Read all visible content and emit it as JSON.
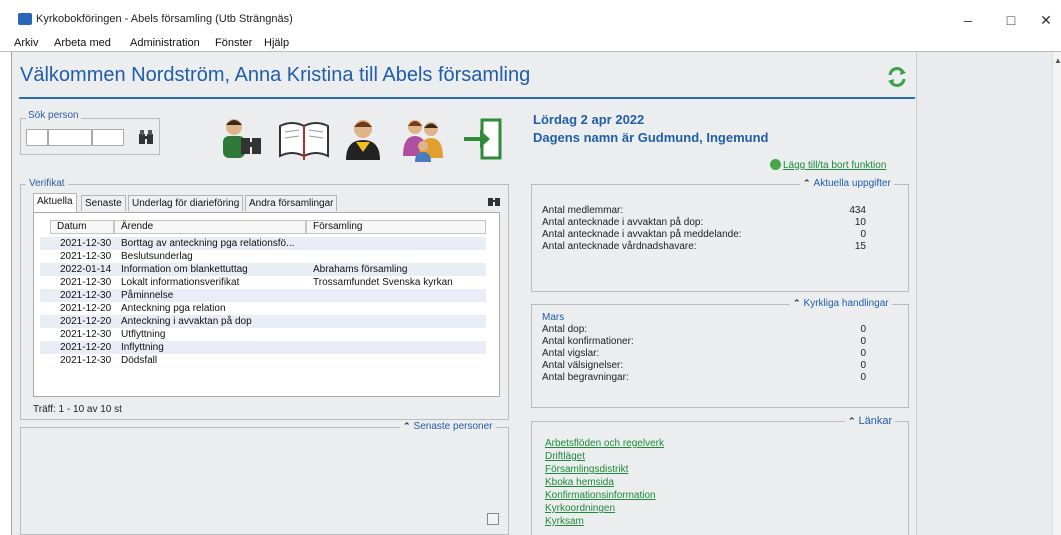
{
  "window": {
    "title": "Kyrkobokföringen - Abels församling (Utb Strängnäs)",
    "min": "–",
    "max": "□",
    "close": "✕"
  },
  "menu": [
    "Arkiv",
    "Arbeta med",
    "Administration",
    "Fönster",
    "Hjälp"
  ],
  "header": {
    "welcome": "Välkommen Nordström, Anna Kristina till Abels församling"
  },
  "sok": {
    "label": "Sök person"
  },
  "date": {
    "today": "Lördag 2 apr 2022",
    "namnsdag": "Dagens namn är Gudmund, Ingemund"
  },
  "add_link": "Lägg till/ta bort funktion",
  "aktuella": {
    "title": "Aktuella uppgifter",
    "rows": [
      {
        "label": "Antal medlemmar:",
        "value": "434"
      },
      {
        "label": "Antal antecknade i avvaktan på dop:",
        "value": "10"
      },
      {
        "label": "Antal antecknade i avvaktan på meddelande:",
        "value": "0"
      },
      {
        "label": "Antal antecknade vårdnadshavare:",
        "value": "15"
      }
    ]
  },
  "kyrkliga": {
    "title": "Kyrkliga handlingar",
    "month": "Mars",
    "rows": [
      {
        "label": "Antal dop:",
        "value": "0"
      },
      {
        "label": "Antal konfirmationer:",
        "value": "0"
      },
      {
        "label": "Antal vigslar:",
        "value": "0"
      },
      {
        "label": "Antal välsignelser:",
        "value": "0"
      },
      {
        "label": "Antal begravningar:",
        "value": "0"
      }
    ]
  },
  "lankar": {
    "title": "Länkar",
    "links": [
      "Arbetsflöden och regelverk",
      "Driftläget",
      "Församlingsdistrikt",
      "Kbokа hemsida",
      "Konfirmationsinformation",
      "Kyrkoordningen",
      "Kyrksam"
    ]
  },
  "verifikat": {
    "title": "Verifikat",
    "tabs": [
      "Aktuella",
      "Senaste",
      "Underlag för diarieföring",
      "Andra församlingar"
    ],
    "columns": [
      "Datum",
      "Ärende",
      "Församling"
    ],
    "rows": [
      {
        "date": "2021-12-30",
        "arende": "Borttag av anteckning pga relationsfö...",
        "forsamling": ""
      },
      {
        "date": "2021-12-30",
        "arende": "Beslutsunderlag",
        "forsamling": ""
      },
      {
        "date": "2022-01-14",
        "arende": "Information om blankettuttag",
        "forsamling": "Abrahams församling"
      },
      {
        "date": "2021-12-30",
        "arende": "Lokalt informationsverifikat",
        "forsamling": "Trossamfundet Svenska kyrkan"
      },
      {
        "date": "2021-12-30",
        "arende": "Påminnelse",
        "forsamling": ""
      },
      {
        "date": "2021-12-20",
        "arende": "Anteckning pga relation",
        "forsamling": ""
      },
      {
        "date": "2021-12-20",
        "arende": "Anteckning i avvaktan på dop",
        "forsamling": ""
      },
      {
        "date": "2021-12-30",
        "arende": "Utflyttning",
        "forsamling": ""
      },
      {
        "date": "2021-12-20",
        "arende": "Inflyttning",
        "forsamling": ""
      },
      {
        "date": "2021-12-30",
        "arende": "Dödsfall",
        "forsamling": ""
      }
    ],
    "traff": "Träff: 1 - 10 av 10 st"
  },
  "senaste_personer": {
    "title": "Senaste personer"
  }
}
